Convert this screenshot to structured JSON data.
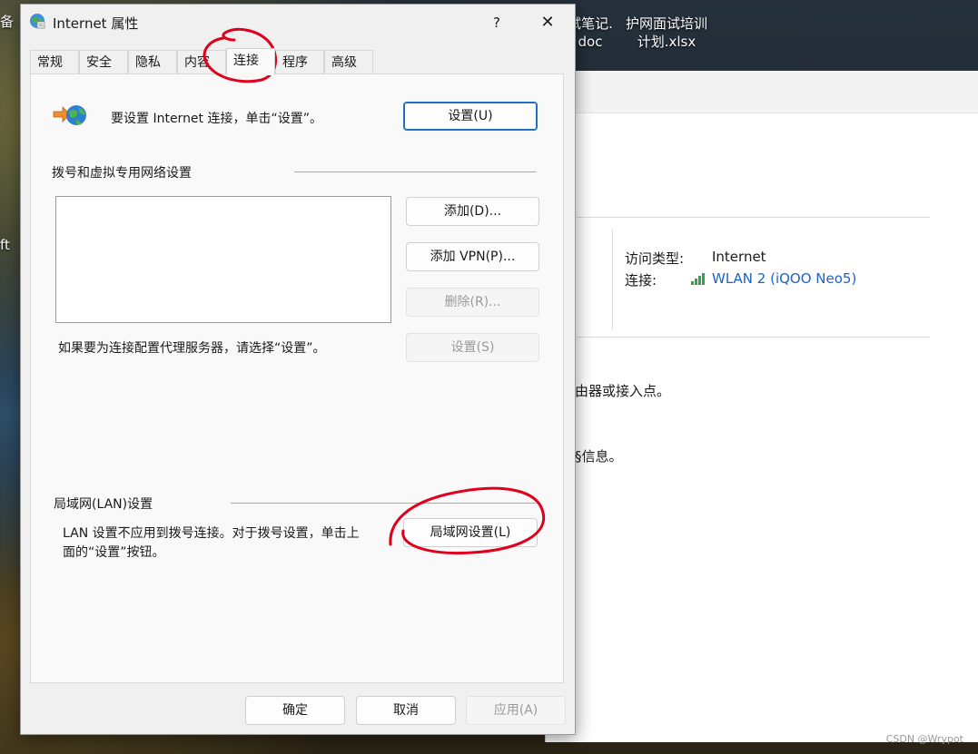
{
  "desktop": {
    "icons": [
      {
        "label_line1": "试笔记.",
        "label_line2": "doc"
      },
      {
        "label_line1": "护网面试培训",
        "label_line2": "计划.xlsx"
      }
    ],
    "left_fragments": [
      "备",
      "ft"
    ]
  },
  "background_window": {
    "access_type_label": "访问类型:",
    "access_type_value": "Internet",
    "connection_label": "连接:",
    "connection_value": "WLAN 2 (iQOO Neo5)",
    "text_fragment_1": "由器或接入点。",
    "text_fragment_2": "§信息。",
    "watermark": "CSDN @Wrypot"
  },
  "dialog": {
    "title": "Internet 属性",
    "help_label": "?",
    "close_label": "✕",
    "tabs": [
      "常规",
      "安全",
      "隐私",
      "内容",
      "连接",
      "程序",
      "高级"
    ],
    "active_tab": "连接",
    "setup": {
      "text": "要设置 Internet 连接，单击“设置”。",
      "button": "设置(U)"
    },
    "dialup": {
      "heading": "拨号和虚拟专用网络设置",
      "add_button": "添加(D)...",
      "add_vpn_button": "添加 VPN(P)...",
      "remove_button": "删除(R)...",
      "settings_button": "设置(S)",
      "proxy_hint": "如果要为连接配置代理服务器，请选择“设置”。"
    },
    "lan": {
      "heading": "局域网(LAN)设置",
      "text_line1": "LAN 设置不应用到拨号连接。对于拨号设置，单击上",
      "text_line2": "面的“设置”按钮。",
      "button": "局域网设置(L)"
    },
    "footer": {
      "ok": "确定",
      "cancel": "取消",
      "apply": "应用(A)"
    }
  },
  "annotations": {
    "color": "#e0001b"
  }
}
